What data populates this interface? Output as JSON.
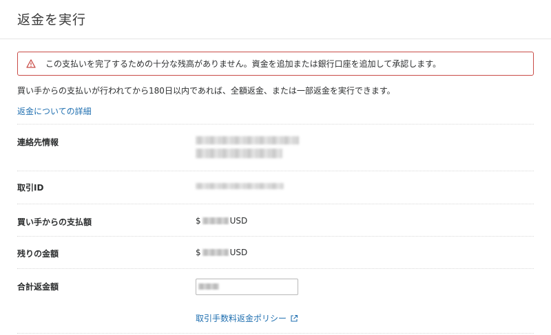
{
  "header": {
    "title": "返金を実行"
  },
  "alert": {
    "icon": "warning-triangle-icon",
    "message": "この支払いを完了するための十分な残高がありません。資金を追加または銀行口座を追加して承認します。",
    "color": "#c84a45"
  },
  "info": {
    "text": "買い手からの支払いが行われてから180日以内であれば、全額返金、または一部返金を実行できます。",
    "details_link": "返金についての詳細"
  },
  "rows": {
    "contact": {
      "label": "連絡先情報"
    },
    "transaction": {
      "label": "取引ID"
    },
    "buyer_payment": {
      "label": "買い手からの支払額",
      "prefix": "$",
      "currency": "USD"
    },
    "remaining": {
      "label": "残りの金額",
      "prefix": "$",
      "currency": "USD"
    },
    "total_refund": {
      "label": "合計返金額",
      "input_value": ""
    }
  },
  "policy_link": {
    "label": "取引手数料返金ポリシー",
    "icon": "external-link-icon"
  },
  "colors": {
    "link": "#1f6fb0",
    "error": "#c84a45",
    "text": "#2c2e2f"
  }
}
